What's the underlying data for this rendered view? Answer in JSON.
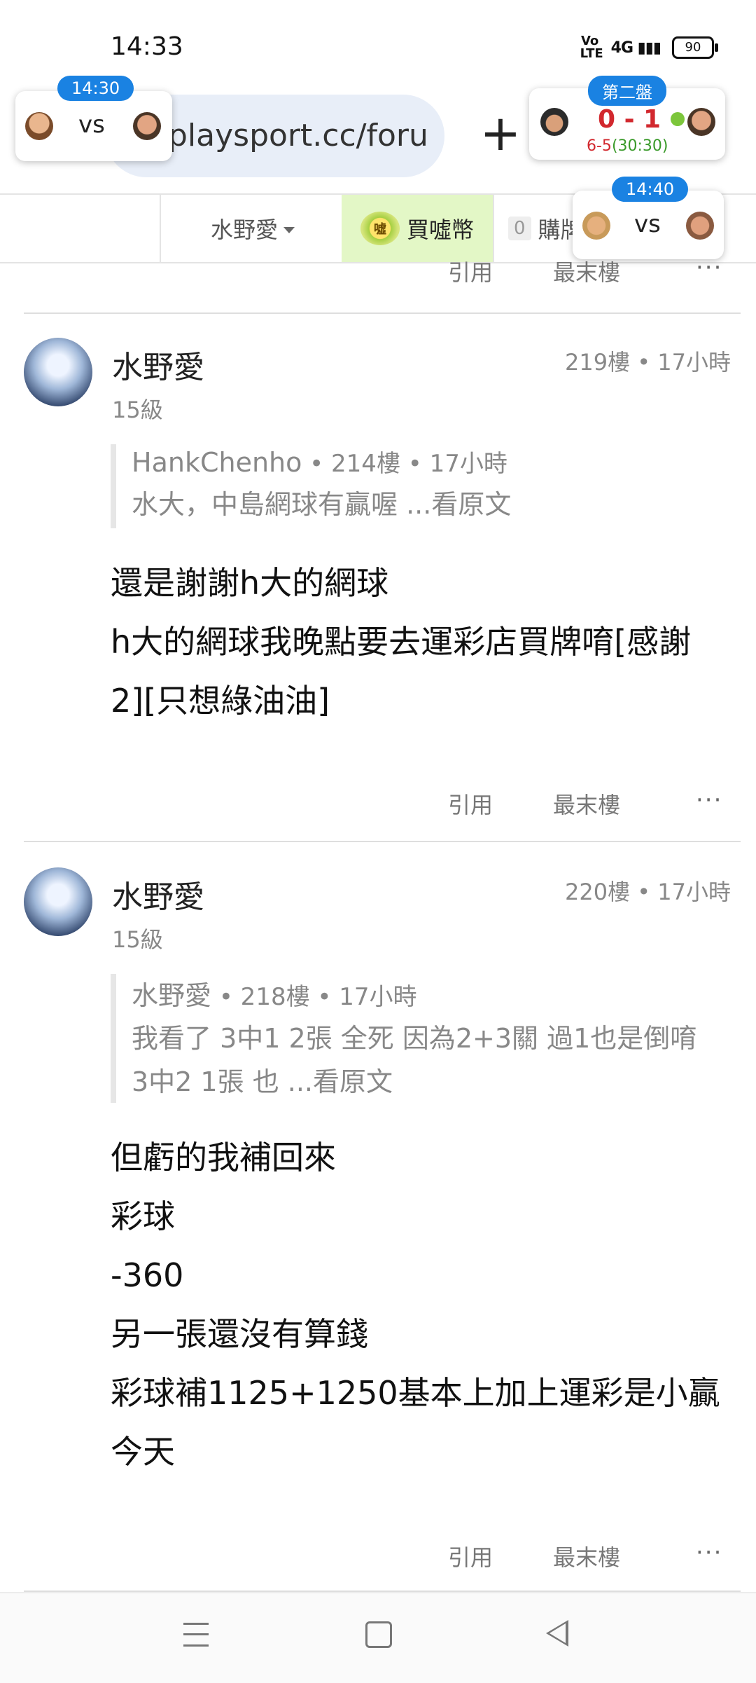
{
  "status_bar": {
    "time": "14:33",
    "volte": "Vo LTE",
    "network": "4G",
    "battery": "90"
  },
  "browser": {
    "url": "playsport.cc/foru",
    "new_tab_label": "+"
  },
  "tabs": {
    "user": "水野愛",
    "coin": "買噓幣",
    "coin_icon_text": "噓",
    "buy_count": "0",
    "buy": "購牌"
  },
  "floating_cards": {
    "left": {
      "time": "14:30",
      "vs": "vs"
    },
    "right": {
      "badge": "第二盤",
      "score": "0 - 1",
      "sets": "6-5",
      "tiebreak": "(30:30)"
    },
    "lower": {
      "time": "14:40",
      "vs": "vs"
    }
  },
  "actions": {
    "quote": "引用",
    "last_floor": "最末樓",
    "more": "···"
  },
  "posts": [
    {
      "username": "水野愛",
      "level": "15級",
      "meta": "219樓 • 17小時",
      "quote": {
        "author": "HankChenho",
        "meta": " • 214樓 • 17小時",
        "lines": [
          "水大，中島網球有贏喔 ...看原文"
        ]
      },
      "lines": [
        "還是謝謝h大的網球",
        "h大的網球我晚點要去運彩店買牌唷[感謝",
        "2][只想綠油油]"
      ]
    },
    {
      "username": "水野愛",
      "level": "15級",
      "meta": "220樓 • 17小時",
      "quote": {
        "author": "水野愛",
        "meta": " • 218樓 • 17小時",
        "lines": [
          "我看了 3中1 2張 全死 因為2+3關 過1也是倒唷",
          "3中2 1張 也 ...看原文"
        ]
      },
      "lines": [
        "但虧的我補回來",
        "彩球",
        "-360",
        "另一張還沒有算錢",
        "彩球補1125+1250基本上加上運彩是小贏",
        "今天"
      ]
    }
  ],
  "nav": {
    "menu_icon": "menu-icon",
    "home_icon": "home-icon",
    "back_icon": "back-icon"
  }
}
